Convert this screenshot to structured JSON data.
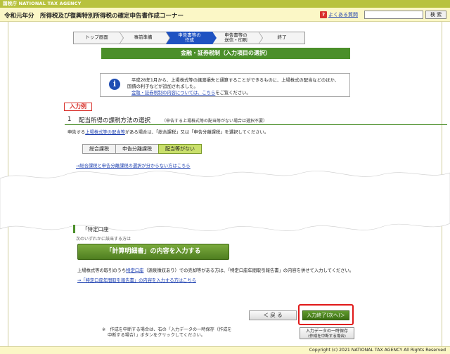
{
  "header": {
    "agency": "国税庁 NATIONAL TAX AGENCY",
    "app_title": "令和元年分　所得税及び復興特別所得税の確定申告書作成コーナー",
    "faq_label": "よくある質問",
    "search_value": "",
    "search_button": "検 索"
  },
  "stepper": [
    {
      "label": "トップ画面"
    },
    {
      "label": "事前準備"
    },
    {
      "label": "申告書等の\n作成",
      "active": true
    },
    {
      "label": "申告書等の\n送信・印刷"
    },
    {
      "label": "終了"
    }
  ],
  "page_title": "金融・証券税制（入力項目の選択）",
  "info": {
    "line1": "平成28年1月から、上場株式等の譲渡損失と通算することができるものに、上場株式の配当などのほか、",
    "line2": "国債の利子などが追加されました。",
    "link": "金融・証券税制の内容については、こちら",
    "link_suffix": "をご覧ください。"
  },
  "example_tag": "入力例",
  "section1": {
    "number": "1",
    "title": "配当所得の課税方法の選択",
    "note": "（申告する上場株式等の配当等がない場合は選択不要）",
    "desc_prefix": "申告する",
    "desc_link": "上場株式等の配当等",
    "desc_suffix": "がある場合は、「総合課税」又は「申告分離課税」を選択してください。",
    "choices": [
      "総合課税",
      "申告分離課税",
      "配当等がない"
    ],
    "selected_index": 2,
    "help_link": "→総合課税と申告分離課税の選択が分からない方はこちら"
  },
  "section2": {
    "partial_title": "「特定口座",
    "partial_desc": "次のいずれかに該当する方は"
  },
  "action_button": "「計算明細書」の内容を入力する",
  "statement": {
    "prefix": "上場株式等の取引のうち",
    "link": "特定口座",
    "suffix": "（源泉徴収あり）での売却等がある方は、「特定口座年間取引報告書」の内容を併せて入力してください。"
  },
  "report_link": "→「特定口座年間取引報告書」の内容を入力する方はこちら",
  "nav": {
    "back": "＜ 戻 る",
    "next": "入力終了(次へ)＞",
    "save_line1": "入力データの一時保存",
    "save_line2": "(作成を中断する場合)"
  },
  "footnote": {
    "line1": "※　作成を中断する場合は、右の「入力データの一時保存（作成を",
    "line2": "中断する場合）」ボタンをクリックしてください。"
  },
  "copyright": "Copyright (c) 2021 NATIONAL TAX AGENCY All Rights Reserved",
  "colors": {
    "header_green": "#b8c23e",
    "title_green": "#4b8f2a",
    "active_step_blue": "#1f52c2",
    "highlight_red": "#e01818"
  }
}
